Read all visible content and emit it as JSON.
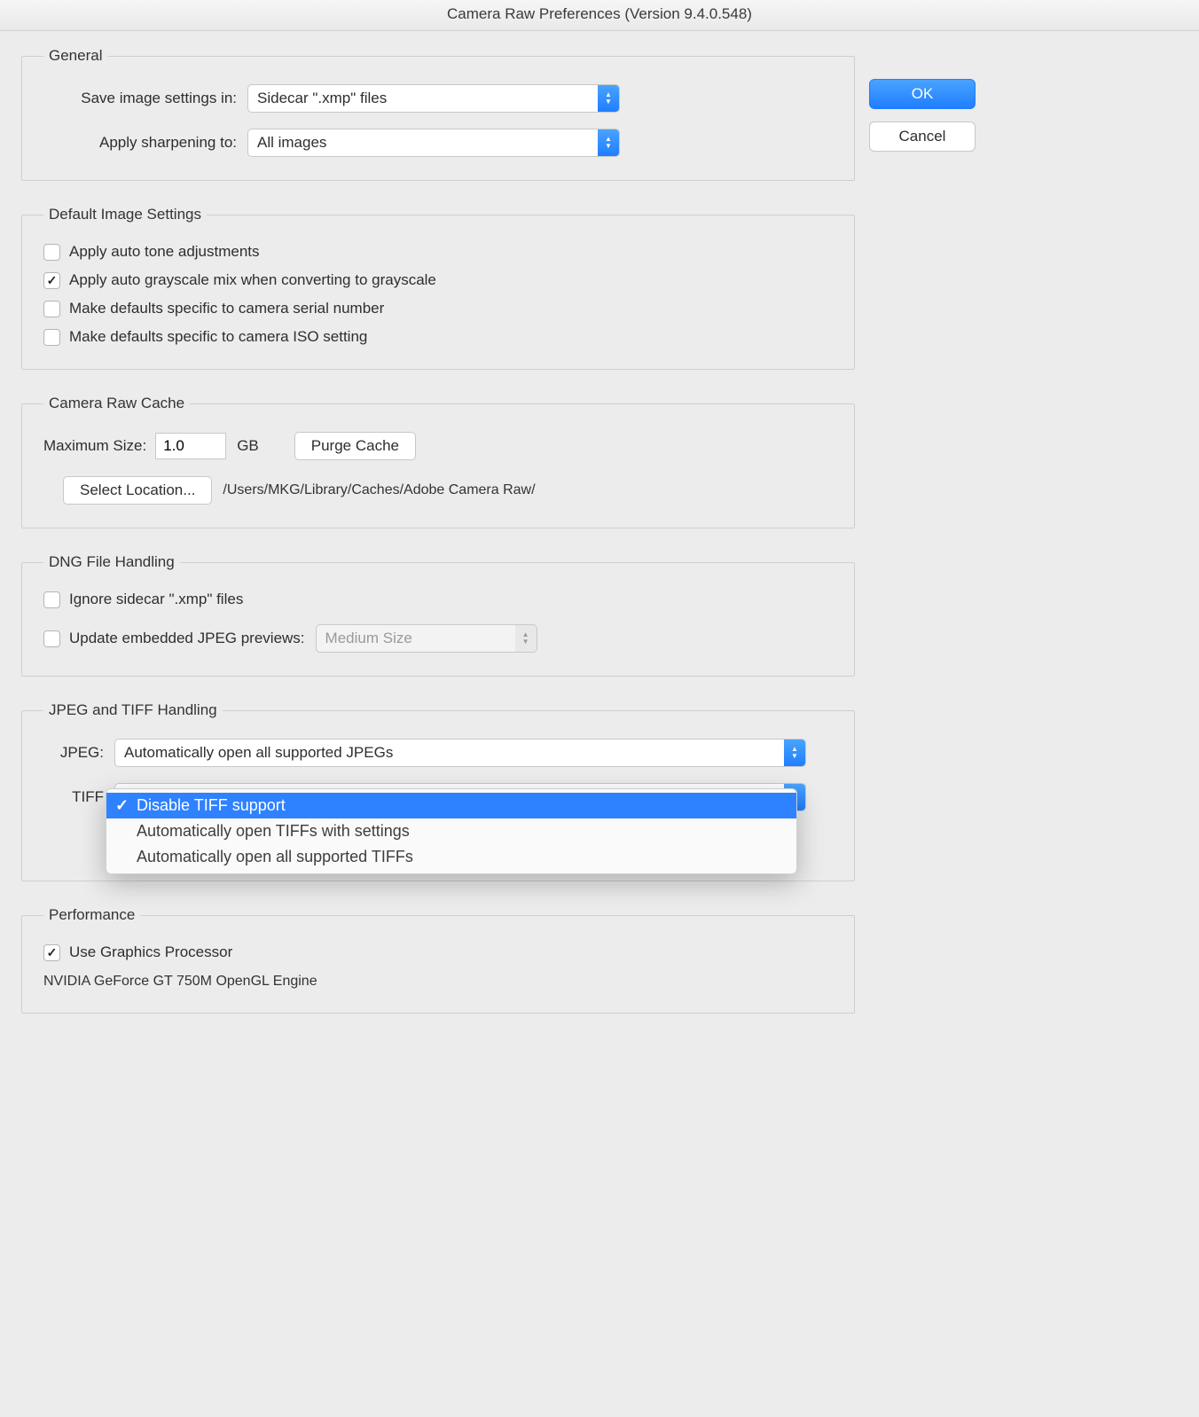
{
  "titlebar": "Camera Raw Preferences  (Version 9.4.0.548)",
  "buttons": {
    "ok": "OK",
    "cancel": "Cancel"
  },
  "general": {
    "legend": "General",
    "save_label": "Save image settings in:",
    "save_value": "Sidecar \".xmp\" files",
    "sharpen_label": "Apply sharpening to:",
    "sharpen_value": "All images"
  },
  "defaults": {
    "legend": "Default Image Settings",
    "auto_tone": "Apply auto tone adjustments",
    "auto_gray": "Apply auto grayscale mix when converting to grayscale",
    "serial": "Make defaults specific to camera serial number",
    "iso": "Make defaults specific to camera ISO setting"
  },
  "cache": {
    "legend": "Camera Raw Cache",
    "max_label": "Maximum Size:",
    "max_value": "1.0",
    "gb": "GB",
    "purge": "Purge Cache",
    "select_loc": "Select Location...",
    "path": "/Users/MKG/Library/Caches/Adobe Camera Raw/"
  },
  "dng": {
    "legend": "DNG File Handling",
    "ignore": "Ignore sidecar \".xmp\" files",
    "update": "Update embedded JPEG previews:",
    "update_value": "Medium Size"
  },
  "jpegtiff": {
    "legend": "JPEG and TIFF Handling",
    "jpeg_label": "JPEG:",
    "jpeg_value": "Automatically open all supported JPEGs",
    "tiff_label": "TIFF",
    "tiff_menu": {
      "opt0": "Disable TIFF support",
      "opt1": "Automatically open TIFFs with settings",
      "opt2": "Automatically open all supported TIFFs"
    }
  },
  "perf": {
    "legend": "Performance",
    "gpu": "Use Graphics Processor",
    "gpu_name": "NVIDIA GeForce GT 750M OpenGL Engine"
  }
}
